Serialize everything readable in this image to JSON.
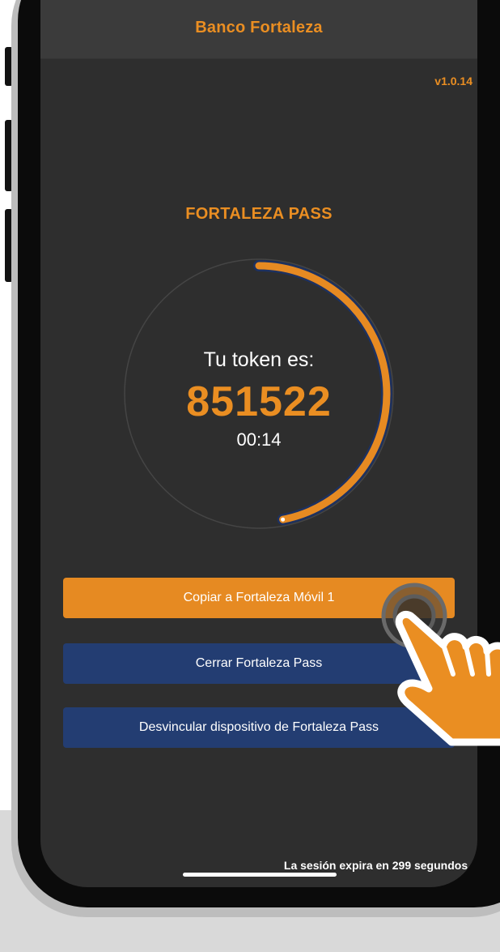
{
  "header": {
    "title": "Banco Fortaleza"
  },
  "version": "v1.0.14",
  "pass": {
    "title": "FORTALEZA PASS",
    "token_label": "Tu token es:",
    "token_value": "851522",
    "timer": "00:14",
    "timer_progress": 0.47
  },
  "buttons": {
    "copy": "Copiar a Fortaleza Móvil 1",
    "close": "Cerrar Fortaleza Pass",
    "unlink": "Desvincular dispositivo de Fortaleza Pass"
  },
  "session_text": "La sesión expira en 299 segundos.",
  "icons": {
    "tap": "tap-indicator-icon",
    "hand": "pointing-hand-icon"
  },
  "colors": {
    "accent": "#ea8e22",
    "primary_button": "#e68a22",
    "secondary_button": "#233d72",
    "screen_background": "#2e2e2e",
    "header_background": "#3b3b3b"
  }
}
